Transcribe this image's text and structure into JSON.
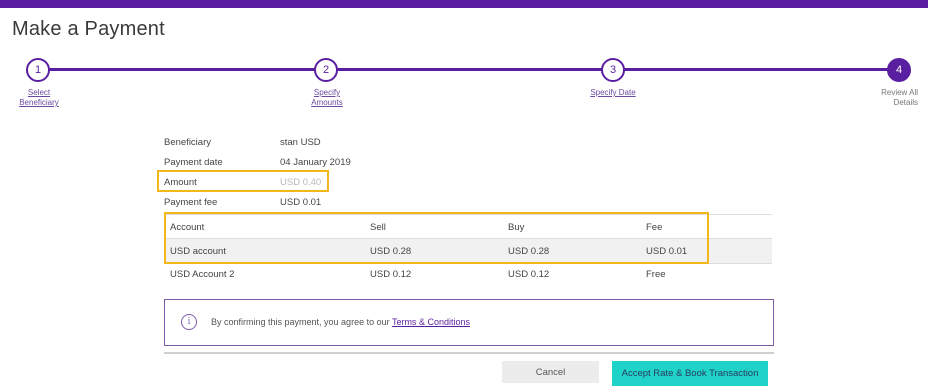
{
  "page": {
    "title": "Make a Payment"
  },
  "colors": {
    "brand": "#5a1fa0",
    "highlight": "#f2b718",
    "accent_button": "#1fd3c8"
  },
  "stepper": {
    "steps": [
      {
        "number": "1",
        "label": "Select Beneficiary",
        "state": "done"
      },
      {
        "number": "2",
        "label": "Specify Amounts",
        "state": "done"
      },
      {
        "number": "3",
        "label": "Specify Date",
        "state": "done"
      },
      {
        "number": "4",
        "label": "Review All Details",
        "state": "current"
      }
    ]
  },
  "summary": {
    "beneficiary": {
      "label": "Beneficiary",
      "value": "stan USD"
    },
    "payment_date": {
      "label": "Payment date",
      "value": "04 January 2019"
    },
    "amount": {
      "label": "Amount",
      "value": "USD 0.40"
    },
    "payment_fee": {
      "label": "Payment fee",
      "value": "USD 0.01"
    }
  },
  "rates_table": {
    "headers": [
      "Account",
      "Sell",
      "Buy",
      "Fee"
    ],
    "rows": [
      [
        "USD account",
        "USD 0.28",
        "USD 0.28",
        "USD 0.01"
      ],
      [
        "USD Account 2",
        "USD 0.12",
        "USD 0.12",
        "Free"
      ]
    ]
  },
  "notice": {
    "icon": "info-icon",
    "text": "By confirming this payment, you agree to our ",
    "link_text": "Terms & Conditions"
  },
  "actions": {
    "cancel_label": "Cancel",
    "accept_label": "Accept Rate & Book Transaction"
  }
}
